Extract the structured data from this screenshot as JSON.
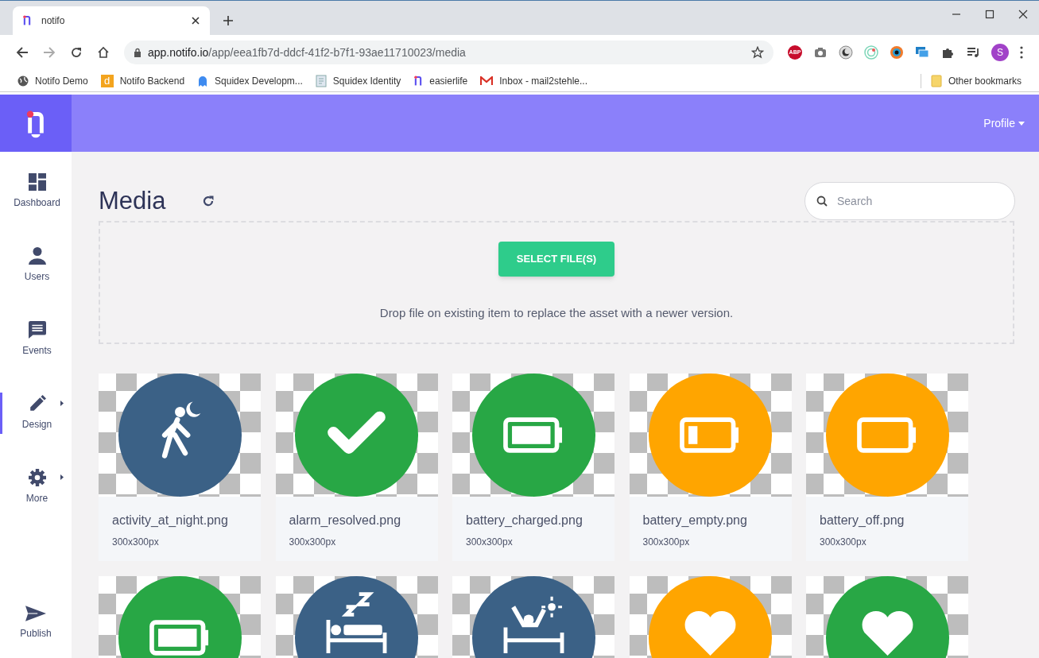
{
  "browser": {
    "tab": {
      "title": "notifo"
    },
    "url": {
      "host": "app.notifo.io",
      "path": "/app/eea1fb7d-ddcf-41f2-b7f1-93ae11710023/media"
    },
    "bookmarks": [
      {
        "label": "Notifo Demo",
        "kind": "globe"
      },
      {
        "label": "Notifo Backend",
        "kind": "letter",
        "letter": "d"
      },
      {
        "label": "Squidex Developm...",
        "kind": "ghost"
      },
      {
        "label": "Squidex Identity",
        "kind": "doc"
      },
      {
        "label": "easierlife",
        "kind": "logo"
      },
      {
        "label": "Inbox - mail2stehle...",
        "kind": "mail"
      }
    ],
    "other_bookmarks": "Other bookmarks",
    "profile_initial": "S",
    "adblock_label": "ABP"
  },
  "header": {
    "profile": "Profile"
  },
  "sidebar": {
    "items": [
      {
        "label": "Dashboard",
        "kind": "dashboard",
        "selected": false,
        "has_submenu": false
      },
      {
        "label": "Users",
        "kind": "user",
        "selected": false,
        "has_submenu": false
      },
      {
        "label": "Events",
        "kind": "message",
        "selected": false,
        "has_submenu": false
      },
      {
        "label": "Design",
        "kind": "pencil",
        "selected": true,
        "has_submenu": true
      },
      {
        "label": "More",
        "kind": "gear",
        "selected": false,
        "has_submenu": true
      }
    ],
    "bottom": {
      "label": "Publish",
      "kind": "send"
    }
  },
  "page": {
    "title": "Media",
    "search": {
      "placeholder": "Search"
    },
    "upload": {
      "button": "SELECT FILE(S)",
      "hint": "Drop file on existing item to replace the asset with a newer version."
    }
  },
  "media": [
    {
      "name": "activity_at_night.png",
      "size": "300x300px",
      "color": "#3b6186",
      "kind": "walk"
    },
    {
      "name": "alarm_resolved.png",
      "size": "300x300px",
      "color": "#28a745",
      "kind": "check"
    },
    {
      "name": "battery_charged.png",
      "size": "300x300px",
      "color": "#28a745",
      "kind": "battery_full"
    },
    {
      "name": "battery_empty.png",
      "size": "300x300px",
      "color": "#ffa500",
      "kind": "battery_low"
    },
    {
      "name": "battery_off.png",
      "size": "300x300px",
      "color": "#ffa500",
      "kind": "battery_off"
    },
    {
      "color": "#28a745",
      "kind": "battery_full"
    },
    {
      "color": "#3b6186",
      "kind": "sleep"
    },
    {
      "color": "#3b6186",
      "kind": "wake"
    },
    {
      "color": "#ffa500",
      "kind": "heart"
    },
    {
      "color": "#28a745",
      "kind": "heart"
    }
  ]
}
